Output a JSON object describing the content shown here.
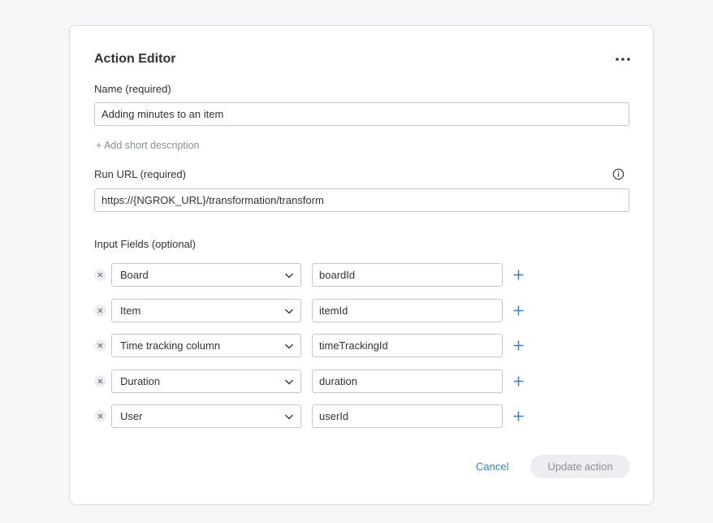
{
  "editor": {
    "title": "Action Editor",
    "name_label": "Name (required)",
    "name_value": "Adding minutes to an item",
    "add_description": "+ Add short description",
    "run_url_label": "Run URL (required)",
    "run_url_value": "https://{NGROK_URL}/transformation/transform",
    "input_fields_label": "Input Fields (optional)",
    "fields": [
      {
        "type": "Board",
        "key": "boardId"
      },
      {
        "type": "Item",
        "key": "itemId"
      },
      {
        "type": "Time tracking column",
        "key": "timeTrackingId"
      },
      {
        "type": "Duration",
        "key": "duration"
      },
      {
        "type": "User",
        "key": "userId"
      }
    ],
    "cancel_label": "Cancel",
    "update_label": "Update action"
  },
  "icons": {
    "more": "more-horizontal-icon",
    "info": "info-icon",
    "remove": "close-icon",
    "chevron": "chevron-down-icon",
    "add": "plus-icon"
  },
  "colors": {
    "accent": "#2f7fd6",
    "border": "#c5c7d0",
    "muted": "#8d8f99",
    "disabled_bg": "#eceef2"
  }
}
